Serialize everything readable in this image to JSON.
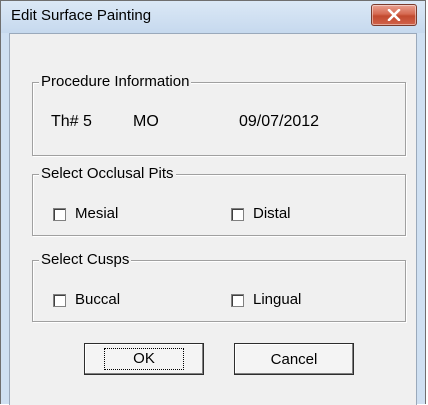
{
  "window": {
    "title": "Edit Surface Painting"
  },
  "procedure": {
    "legend": "Procedure Information",
    "tooth": "Th# 5",
    "surface": "MO",
    "date": "09/07/2012"
  },
  "occlusal_pits": {
    "legend": "Select Occlusal Pits",
    "options": [
      {
        "label": "Mesial",
        "checked": false
      },
      {
        "label": "Distal",
        "checked": false
      }
    ]
  },
  "cusps": {
    "legend": "Select Cusps",
    "options": [
      {
        "label": "Buccal",
        "checked": false
      },
      {
        "label": "Lingual",
        "checked": false
      }
    ]
  },
  "buttons": {
    "ok": "OK",
    "cancel": "Cancel"
  },
  "icons": {
    "close": "close-icon"
  },
  "colors": {
    "close_button": "#c74a31",
    "titlebar": "#cfe0f2",
    "dialog_bg": "#f0f0f0"
  }
}
